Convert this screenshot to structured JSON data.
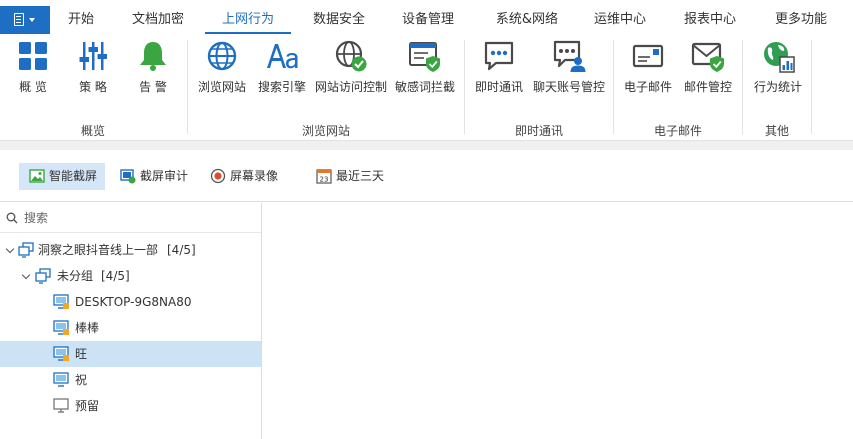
{
  "menu": {
    "tabs": [
      {
        "label": "开始"
      },
      {
        "label": "文档加密"
      },
      {
        "label": "上网行为"
      },
      {
        "label": "数据安全"
      },
      {
        "label": "设备管理"
      },
      {
        "label": "系统&网络"
      },
      {
        "label": "运维中心"
      },
      {
        "label": "报表中心"
      },
      {
        "label": "更多功能"
      }
    ],
    "active_tab": "上网行为"
  },
  "ribbon": {
    "groups": [
      {
        "label": "概览",
        "buttons": [
          {
            "label": "概 览",
            "icon": "overview-grid-icon"
          },
          {
            "label": "策 略",
            "icon": "policy-sliders-icon"
          },
          {
            "label": "告 警",
            "icon": "alarm-bell-icon"
          }
        ]
      },
      {
        "label": "浏览网站",
        "buttons": [
          {
            "label": "浏览网站",
            "icon": "globe-icon"
          },
          {
            "label": "搜索引擎",
            "icon": "font-aa-icon"
          },
          {
            "label": "网站访问控制",
            "icon": "globe-check-icon"
          },
          {
            "label": "敏感词拦截",
            "icon": "window-shield-icon"
          }
        ]
      },
      {
        "label": "即时通讯",
        "buttons": [
          {
            "label": "即时通讯",
            "icon": "chat-bubble-icon"
          },
          {
            "label": "聊天账号管控",
            "icon": "chat-user-icon"
          }
        ]
      },
      {
        "label": "电子邮件",
        "buttons": [
          {
            "label": "电子邮件",
            "icon": "email-icon"
          },
          {
            "label": "邮件管控",
            "icon": "email-shield-icon"
          }
        ]
      },
      {
        "label": "其他",
        "buttons": [
          {
            "label": "行为统计",
            "icon": "globe-stats-icon"
          }
        ]
      }
    ]
  },
  "toolbar": {
    "buttons": [
      {
        "label": "智能截屏",
        "icon": "picture-icon",
        "active": true
      },
      {
        "label": "截屏审计",
        "icon": "screen-audit-icon",
        "active": false
      },
      {
        "label": "屏幕录像",
        "icon": "record-icon",
        "active": false
      },
      {
        "label": "最近三天",
        "icon": "calendar-icon",
        "active": false
      }
    ],
    "calendar_day": "23"
  },
  "tree": {
    "search_placeholder": "搜索",
    "nodes": [
      {
        "label": "洞察之眼抖音线上一部",
        "count": "[4/5]",
        "level": 0,
        "type": "group"
      },
      {
        "label": "未分组",
        "count": "[4/5]",
        "level": 1,
        "type": "group"
      },
      {
        "label": "DESKTOP-9G8NA80",
        "level": 2,
        "type": "computer-online"
      },
      {
        "label": "棒棒",
        "level": 2,
        "type": "computer-online"
      },
      {
        "label": "旺",
        "level": 2,
        "type": "computer-online",
        "selected": true
      },
      {
        "label": "祝",
        "level": 2,
        "type": "computer-online"
      },
      {
        "label": "预留",
        "level": 2,
        "type": "computer-offline"
      }
    ]
  },
  "colors": {
    "accent": "#1e6fc4",
    "selected_row": "#cce3f6",
    "active_tool": "#d4e6f7",
    "bell_green": "#3aa541"
  }
}
